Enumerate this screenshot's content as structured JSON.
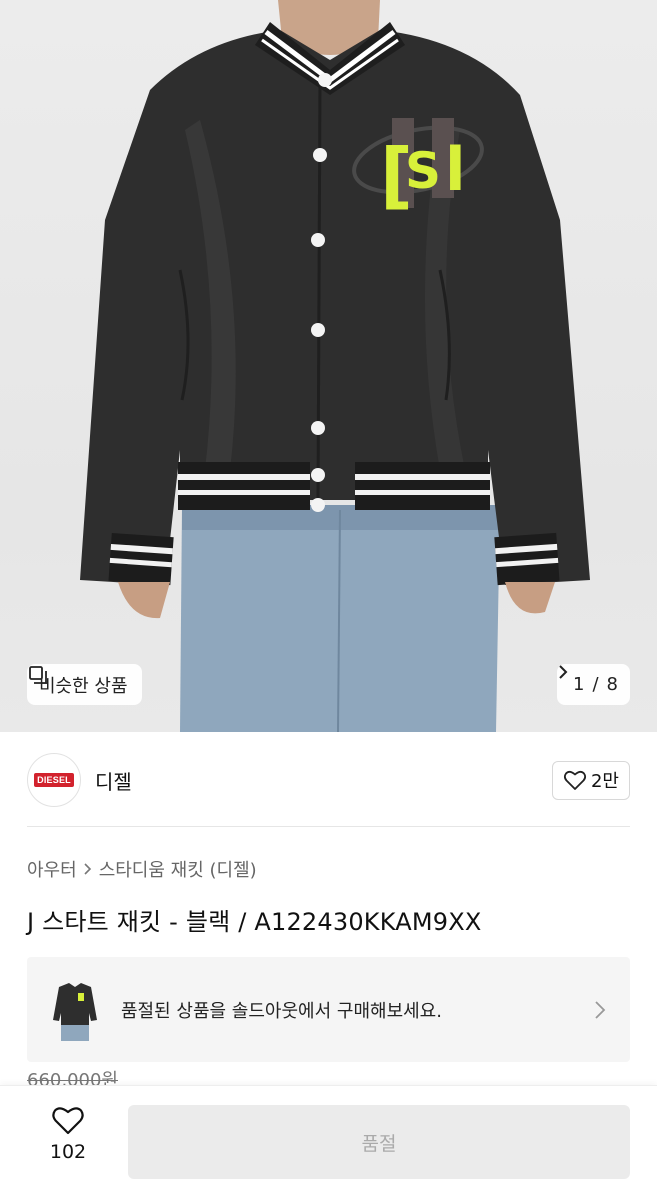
{
  "hero": {
    "image_alt": "black stadium jacket product photo",
    "similar_label": "비슷한 상품",
    "pager_current": "1",
    "pager_separator": "/",
    "pager_total": "8"
  },
  "brand": {
    "logo_text": "DIESEL",
    "name": "디젤",
    "like_count": "2만"
  },
  "breadcrumb": {
    "category": "아우터",
    "subcategory": "스타디움 재킷 (디젤)"
  },
  "product": {
    "title": "J 스타트 재킷 - 블랙 / A122430KKAM9XX",
    "original_price": "660,000원"
  },
  "soldout_banner": {
    "message": "품절된 상품을 솔드아웃에서 구매해보세요."
  },
  "bottom_bar": {
    "wish_count": "102",
    "buy_label": "품절"
  },
  "colors": {
    "jacket": "#2e2e2e",
    "patch_neon": "#d8f03a",
    "brand_red": "#d2222d",
    "disabled_button": "#ebebeb"
  }
}
